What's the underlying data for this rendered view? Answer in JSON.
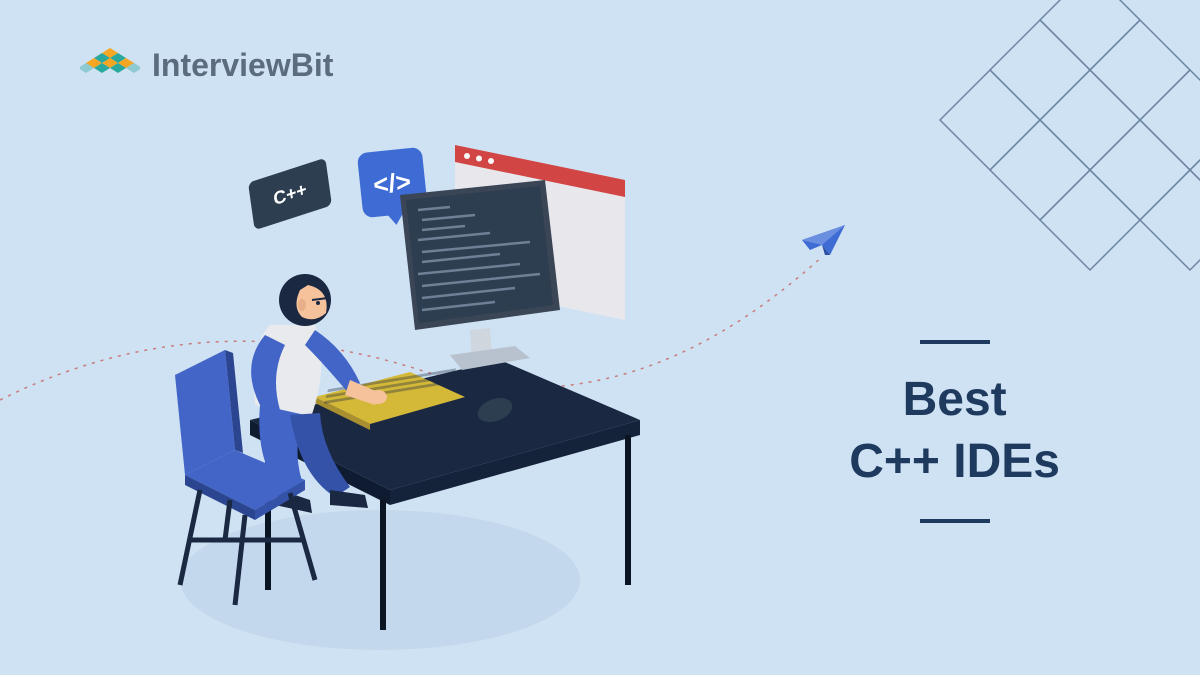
{
  "brand": {
    "name": "InterviewBit"
  },
  "title": {
    "line1": "Best",
    "line2": "C++ IDEs"
  },
  "tags": {
    "cpp": "C++",
    "code": "</>"
  }
}
